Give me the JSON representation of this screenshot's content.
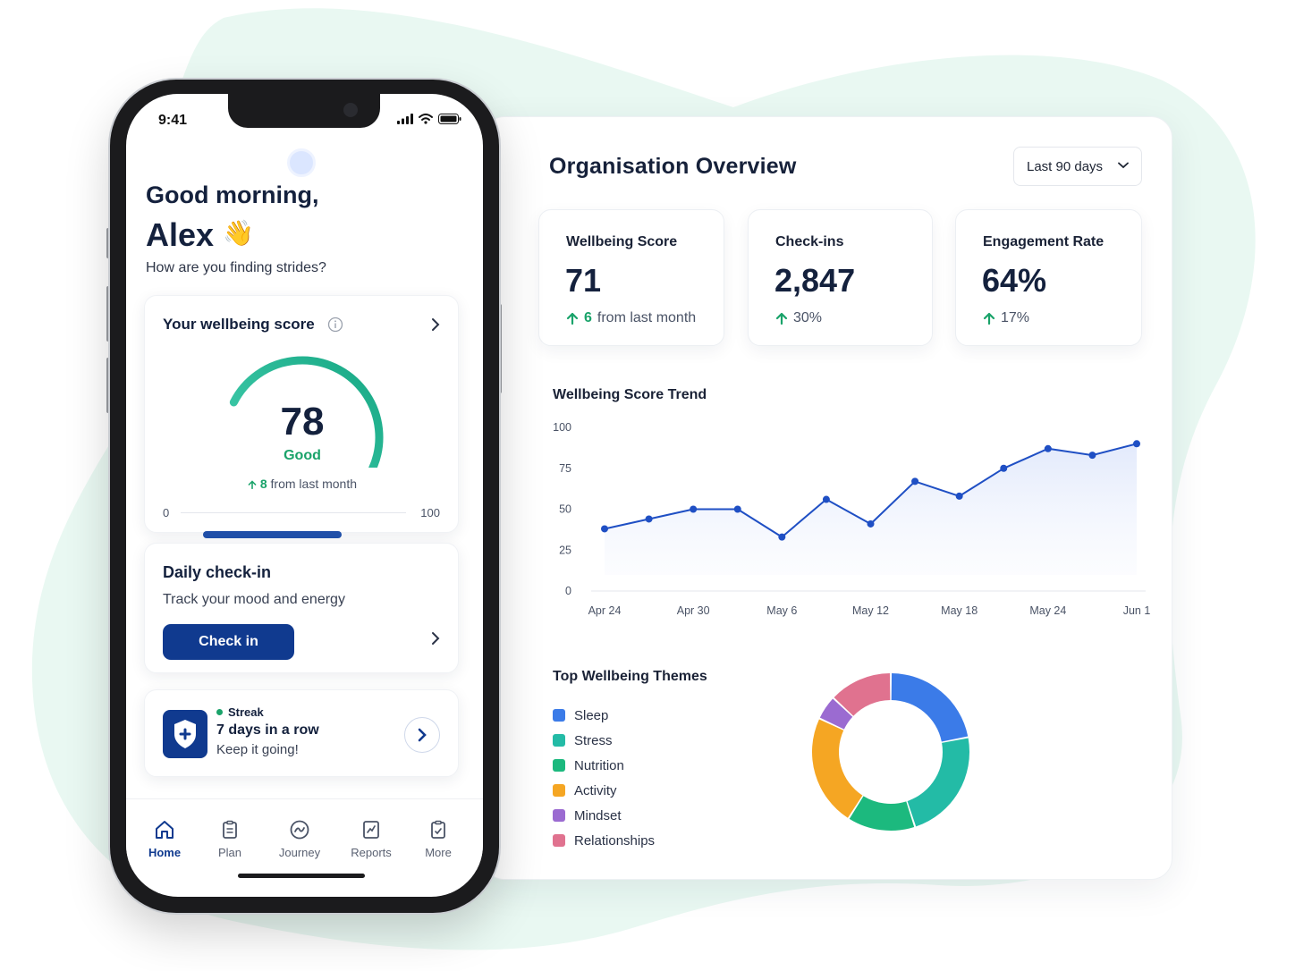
{
  "colors": {
    "primary": "#103a8f",
    "accent_green": "#1aa36a",
    "teal": "#2fc2a5",
    "blob": "#e7f8f1",
    "chart_line": "#1f4fc4"
  },
  "phone": {
    "status_time": "9:41",
    "greeting": "Good morning,",
    "name": "Alex",
    "wave_emoji": "👋",
    "subtitle": "How are you finding strides?",
    "score_card": {
      "title": "Your wellbeing score",
      "score": "78",
      "score_fraction": 0.78,
      "label": "Good",
      "change_value": "8",
      "change_text": "from last month",
      "scale_min": "0",
      "scale_max": "100"
    },
    "checkin_card": {
      "title": "Daily check-in",
      "subtitle": "Track your mood and energy",
      "button": "Check in"
    },
    "streak_card": {
      "tag": "Streak",
      "title": "7 days in a row",
      "subtitle": "Keep it going!"
    },
    "tabs": [
      {
        "label": "Home",
        "icon": "home-icon",
        "active": true
      },
      {
        "label": "Plan",
        "icon": "clipboard-icon",
        "active": false
      },
      {
        "label": "Journey",
        "icon": "compass-icon",
        "active": false
      },
      {
        "label": "Reports",
        "icon": "report-icon",
        "active": false
      },
      {
        "label": "More",
        "icon": "more-icon",
        "active": false
      }
    ]
  },
  "dashboard": {
    "title": "Organisation Overview",
    "range": "Last 90 days",
    "kpis": [
      {
        "label": "Wellbeing Score",
        "value": "71",
        "change": "6",
        "change_suffix": "from last month"
      },
      {
        "label": "Check-ins",
        "value": "2,847",
        "change": "30%",
        "change_suffix": ""
      },
      {
        "label": "Engagement Rate",
        "value": "64%",
        "change": "17%",
        "change_suffix": ""
      }
    ],
    "trend_title": "Wellbeing Score Trend",
    "themes_title": "Top Wellbeing Themes"
  },
  "chart_data": [
    {
      "type": "line",
      "title": "Wellbeing Score Trend",
      "x_tick_labels": [
        "Apr 24",
        "Apr 30",
        "May 6",
        "May 12",
        "May 18",
        "May 24",
        "Jun 1"
      ],
      "y_ticks": [
        0,
        25,
        50,
        75,
        100
      ],
      "ylim": [
        0,
        100
      ],
      "series": [
        {
          "values": [
            38,
            44,
            50,
            50,
            33,
            56,
            41,
            67,
            58,
            75,
            87,
            83,
            90
          ]
        }
      ],
      "area_fill": true,
      "grid": false
    },
    {
      "type": "pie",
      "title": "Top Wellbeing Themes",
      "donut": true,
      "labels": [
        "Sleep",
        "Stress",
        "Nutrition",
        "Activity",
        "Mindset",
        "Relationships"
      ],
      "values": [
        22,
        23,
        14,
        23,
        5,
        13
      ],
      "colors": [
        "#3b7be8",
        "#23bba6",
        "#1cb97e",
        "#f5a623",
        "#9b6bd1",
        "#e0728f"
      ]
    }
  ]
}
